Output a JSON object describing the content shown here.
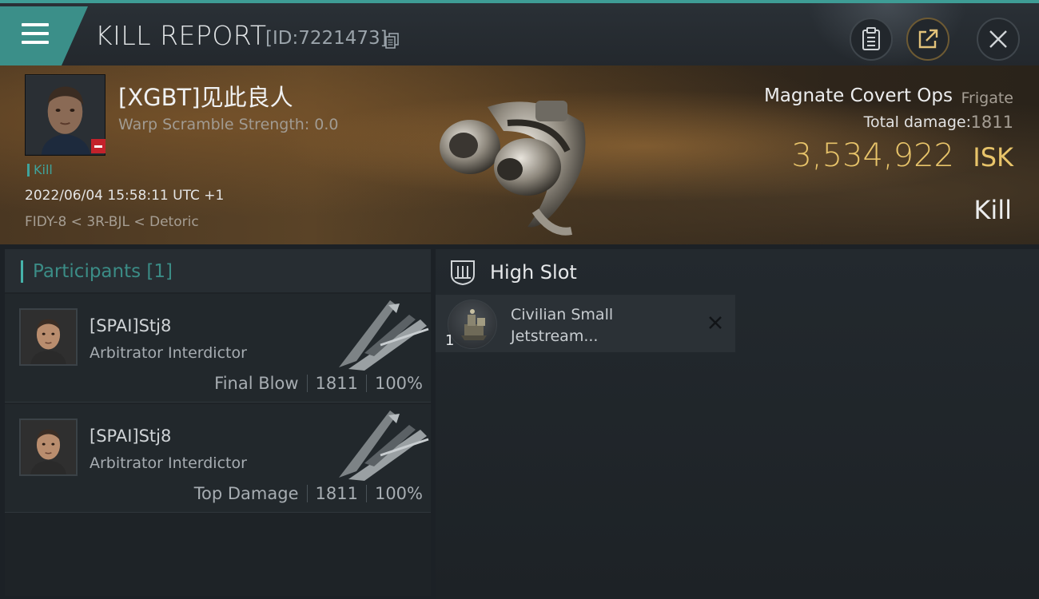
{
  "header": {
    "title": "KILL REPORT",
    "report_id": "[ID:7221473]",
    "icons": [
      "menu-icon",
      "copy-icon",
      "clipboard-icon",
      "share-icon",
      "close-icon"
    ]
  },
  "victim": {
    "name": "[XGBT]见此良人",
    "warp_scramble": "Warp Scramble Strength: 0.0",
    "kill_tag": "Kill",
    "timestamp": "2022/06/04 15:58:11 UTC +1",
    "location": "FIDY-8 < 3R-BJL < Detoric",
    "ship_name": "Magnate Covert Ops",
    "ship_class": "Frigate",
    "total_damage_label": "Total damage:",
    "total_damage": "1811",
    "isk_value": "3,534,922",
    "isk_unit": "ISK",
    "kill_type": "Kill"
  },
  "participants": {
    "title": "Participants [1]",
    "rows": [
      {
        "name": "[SPAI]Stj8",
        "ship": "Arbitrator Interdictor",
        "role": "Final Blow",
        "damage": "1811",
        "percent": "100%"
      },
      {
        "name": "[SPAI]Stj8",
        "ship": "Arbitrator Interdictor",
        "role": "Top Damage",
        "damage": "1811",
        "percent": "100%"
      }
    ]
  },
  "fitting": {
    "slot_title": "High Slot",
    "modules": [
      {
        "quantity": "1",
        "name_line1": "Civilian Small",
        "name_line2": "Jetstream..."
      }
    ]
  },
  "colors": {
    "accent_teal": "#3e9c95",
    "isk_gold": "#e8c46a",
    "destroyed_red": "#c3222b"
  }
}
